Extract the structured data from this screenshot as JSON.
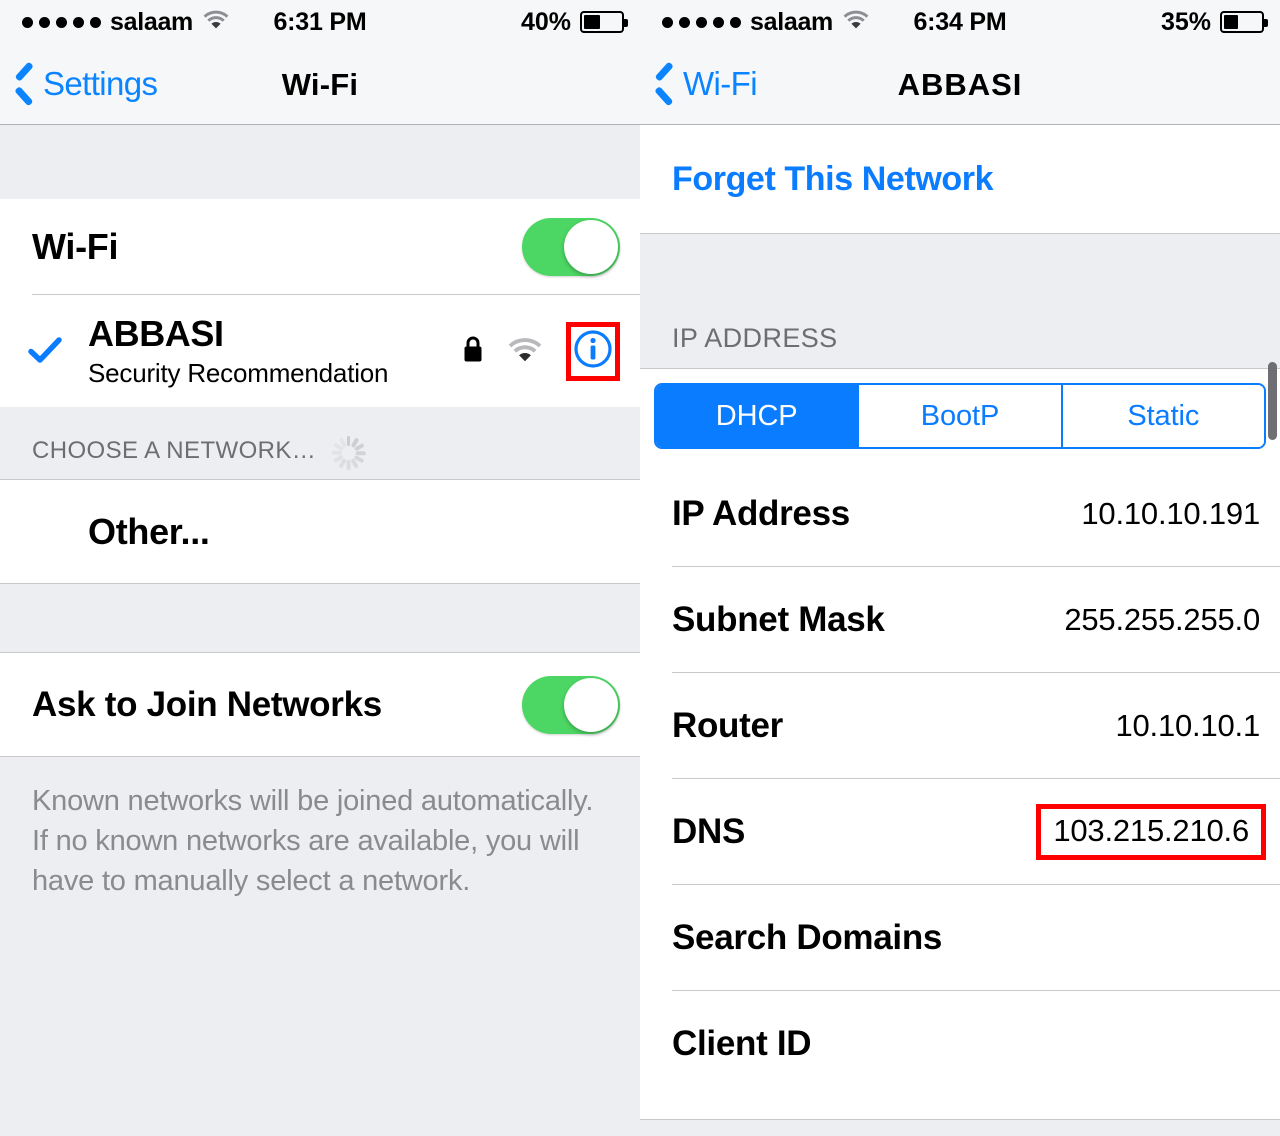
{
  "left": {
    "status_bar": {
      "signal_dots": 5,
      "carrier": "salaam",
      "wifi_icon": "wifi-icon",
      "time": "6:31 PM",
      "battery_percent": "40%",
      "battery_level": 40
    },
    "nav": {
      "back_label": "Settings",
      "back_icon": "chevron-left-icon",
      "title": "Wi-Fi"
    },
    "wifi_toggle_row": {
      "label": "Wi-Fi",
      "toggle_on": true
    },
    "connected_network": {
      "checkmark_icon": "checkmark-icon",
      "ssid": "ABBASI",
      "subtitle": "Security Recommendation",
      "lock_icon": "lock-icon",
      "signal_icon": "wifi-icon",
      "info_icon": "info-circle-icon",
      "info_highlighted": true
    },
    "choose_network": {
      "header": "CHOOSE A NETWORK…",
      "spinner_icon": "activity-spinner-icon",
      "other_label": "Other..."
    },
    "ask_to_join": {
      "label": "Ask to Join Networks",
      "toggle_on": true
    },
    "footer_note": "Known networks will be joined automatically. If no known networks are available, you will have to manually select a network."
  },
  "right": {
    "status_bar": {
      "signal_dots": 5,
      "carrier": "salaam",
      "wifi_icon": "wifi-icon",
      "time": "6:34 PM",
      "battery_percent": "35%",
      "battery_level": 35
    },
    "nav": {
      "back_label": "Wi-Fi",
      "back_icon": "chevron-left-icon",
      "title": "ABBASI"
    },
    "forget_network_label": "Forget This Network",
    "ip_section_header": "IP ADDRESS",
    "segmented": {
      "options": [
        "DHCP",
        "BootP",
        "Static"
      ],
      "selected": "DHCP",
      "accent_color": "#0a7cff"
    },
    "detail_rows": [
      {
        "label": "IP Address",
        "value": "10.10.10.191",
        "highlighted": false
      },
      {
        "label": "Subnet Mask",
        "value": "255.255.255.0",
        "highlighted": false
      },
      {
        "label": "Router",
        "value": "10.10.10.1",
        "highlighted": false
      },
      {
        "label": "DNS",
        "value": "103.215.210.6",
        "highlighted": true
      },
      {
        "label": "Search Domains",
        "value": "",
        "highlighted": false
      },
      {
        "label": "Client ID",
        "value": "",
        "highlighted": false
      }
    ]
  },
  "colors": {
    "ios_blue": "#0a7cff",
    "ios_green": "#4cd764",
    "highlight_red": "#ff0000",
    "group_bg": "#eceef1",
    "row_bg": "#ffffff"
  }
}
